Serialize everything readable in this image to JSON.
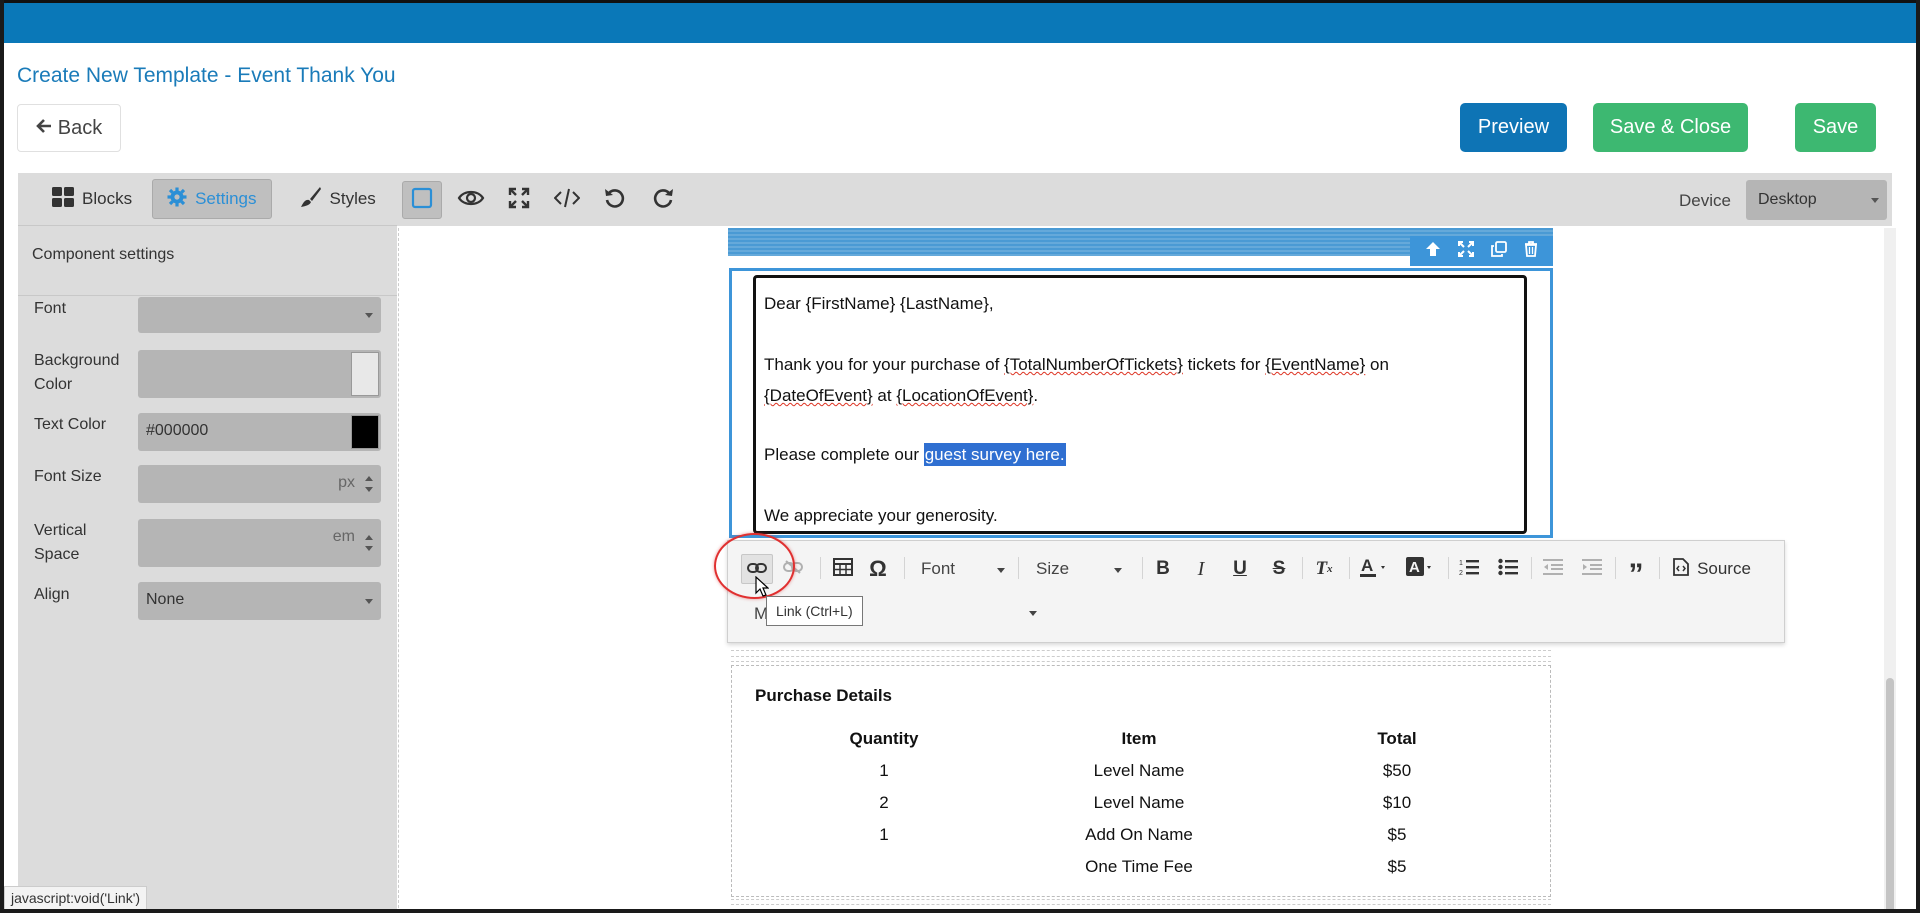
{
  "header": {
    "title": "Create New Template - Event Thank You",
    "back_label": "Back",
    "preview_label": "Preview",
    "save_close_label": "Save & Close",
    "save_label": "Save"
  },
  "left_panel": {
    "tabs": [
      {
        "label": "Blocks",
        "icon": "grid-icon"
      },
      {
        "label": "Settings",
        "icon": "gear-icon",
        "active": true
      },
      {
        "label": "Styles",
        "icon": "brush-icon"
      }
    ],
    "section_title": "Component settings",
    "fields": {
      "font": {
        "label": "Font",
        "value": ""
      },
      "background_color": {
        "label": "Background Color",
        "value": ""
      },
      "text_color": {
        "label": "Text Color",
        "value": "#000000"
      },
      "font_size": {
        "label": "Font Size",
        "unit": "px"
      },
      "vertical_space": {
        "label": "Vertical Space",
        "unit": "em"
      },
      "align": {
        "label": "Align",
        "value": "None"
      }
    }
  },
  "toolbar": {
    "icons": [
      "square-icon",
      "eye-icon",
      "fullscreen-icon",
      "code-icon",
      "undo-icon",
      "redo-icon"
    ],
    "device_label": "Device",
    "device_value": "Desktop"
  },
  "email": {
    "greeting": "Dear {FirstName} {LastName},",
    "line1_a": "Thank you for your purchase of ",
    "tickets_var": "{TotalNumberOfTickets}",
    "line1_b": " tickets for ",
    "event_var": "{EventName}",
    "line1_c": " on",
    "date_var": "{DateOfEvent}",
    "line2_b": " at ",
    "location_var": "{LocationOfEvent}",
    "line2_c": ".",
    "survey_prefix": "Please complete our ",
    "survey_link": "guest survey here.",
    "closing": "We appreciate your generosity."
  },
  "rte": {
    "font_label": "Font",
    "size_label": "Size",
    "source_label": "Source",
    "tooltip": "Link (Ctrl+L)",
    "row2_text": "M"
  },
  "purchase_details": {
    "title": "Purchase Details",
    "columns": [
      "Quantity",
      "Item",
      "Total"
    ],
    "rows": [
      {
        "quantity": "1",
        "item": "Level Name",
        "total": "$50"
      },
      {
        "quantity": "2",
        "item": "Level Name",
        "total": "$10"
      },
      {
        "quantity": "1",
        "item": "Add On Name",
        "total": "$5"
      },
      {
        "quantity": "",
        "item": "One Time Fee",
        "total": "$5"
      }
    ]
  },
  "status_bar": "javascript:void('Link')",
  "colors": {
    "topbar": "#0a78b8",
    "preview": "#0e74b5",
    "save": "#3db871",
    "selection": "#3d95d9"
  }
}
